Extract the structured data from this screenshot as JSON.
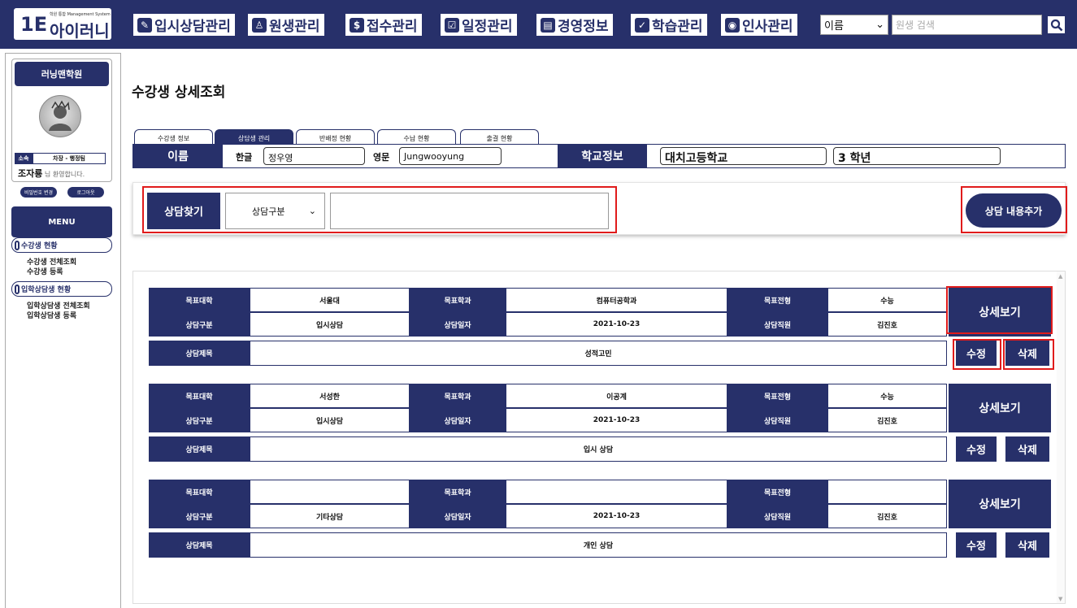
{
  "header": {
    "logo_mark": "1E",
    "logo_sub": "학원 통합 Management System",
    "logo_text": "아이러니",
    "nav": [
      {
        "icon": "✎",
        "label": "입시상담관리"
      },
      {
        "icon": "♙",
        "label": "원생관리"
      },
      {
        "icon": "$",
        "label": "접수관리"
      },
      {
        "icon": "☑",
        "label": "일정관리"
      },
      {
        "icon": "▤",
        "label": "경영정보"
      },
      {
        "icon": "✓",
        "label": "학습관리"
      },
      {
        "icon": "◉",
        "label": "인사관리"
      }
    ],
    "search_type": "이름",
    "search_placeholder": "원생 검색",
    "search_icon": "search-icon"
  },
  "sidebar": {
    "academy": "러닝맨학원",
    "dept_tag": "소속",
    "dept_value": "차장 - 행정팀",
    "user_name": "조자룡",
    "user_suffix": " 님 환영합니다.",
    "change_password": "비밀번호 변경",
    "logout": "로그아웃",
    "menu_title": "MENU",
    "groups": [
      {
        "label": "수강생 현황",
        "items": [
          "수강생 전체조회",
          "수강생 등록"
        ]
      },
      {
        "label": "입학상담생 현황",
        "items": [
          "입학상담생 전체조회",
          "입학상담생 등록"
        ]
      }
    ]
  },
  "main": {
    "page_title": "수강생 상세조회",
    "tabs": [
      "수강생 정보",
      "상담생 관리",
      "반배정 현황",
      "수납 현황",
      "출결 현황"
    ],
    "active_tab": 1,
    "info": {
      "name_head": "이름",
      "korean_label": "한글",
      "korean_value": "정우영",
      "english_label": "영문",
      "english_value": "Jungwooyung",
      "school_head": "학교정보",
      "school_value": "대치고등학교",
      "grade_value": "3 학년"
    },
    "search": {
      "label": "상담찾기",
      "type": "상담구분",
      "value": ""
    },
    "add_button": "상담 내용추가",
    "labels": {
      "target_univ": "목표대학",
      "target_major": "목표학과",
      "target_type": "목표전형",
      "consult_type": "상담구분",
      "consult_date": "상담일자",
      "consult_staff": "상담직원",
      "consult_title": "상담제목",
      "detail": "상세보기",
      "edit": "수정",
      "delete": "삭제"
    },
    "records": [
      {
        "univ": "서울대",
        "major": "컴퓨터공학과",
        "track": "수능",
        "type": "입시상담",
        "date": "2021-10-23",
        "staff": "김진호",
        "title": "성적고민"
      },
      {
        "univ": "서성한",
        "major": "이공계",
        "track": "수능",
        "type": "입시상담",
        "date": "2021-10-23",
        "staff": "김진호",
        "title": "입시 상담"
      },
      {
        "univ": "",
        "major": "",
        "track": "",
        "type": "기타상담",
        "date": "2021-10-23",
        "staff": "김진호",
        "title": "개인 상담"
      }
    ]
  },
  "colors": {
    "brand": "#27306a",
    "highlight": "#e01b1b"
  }
}
